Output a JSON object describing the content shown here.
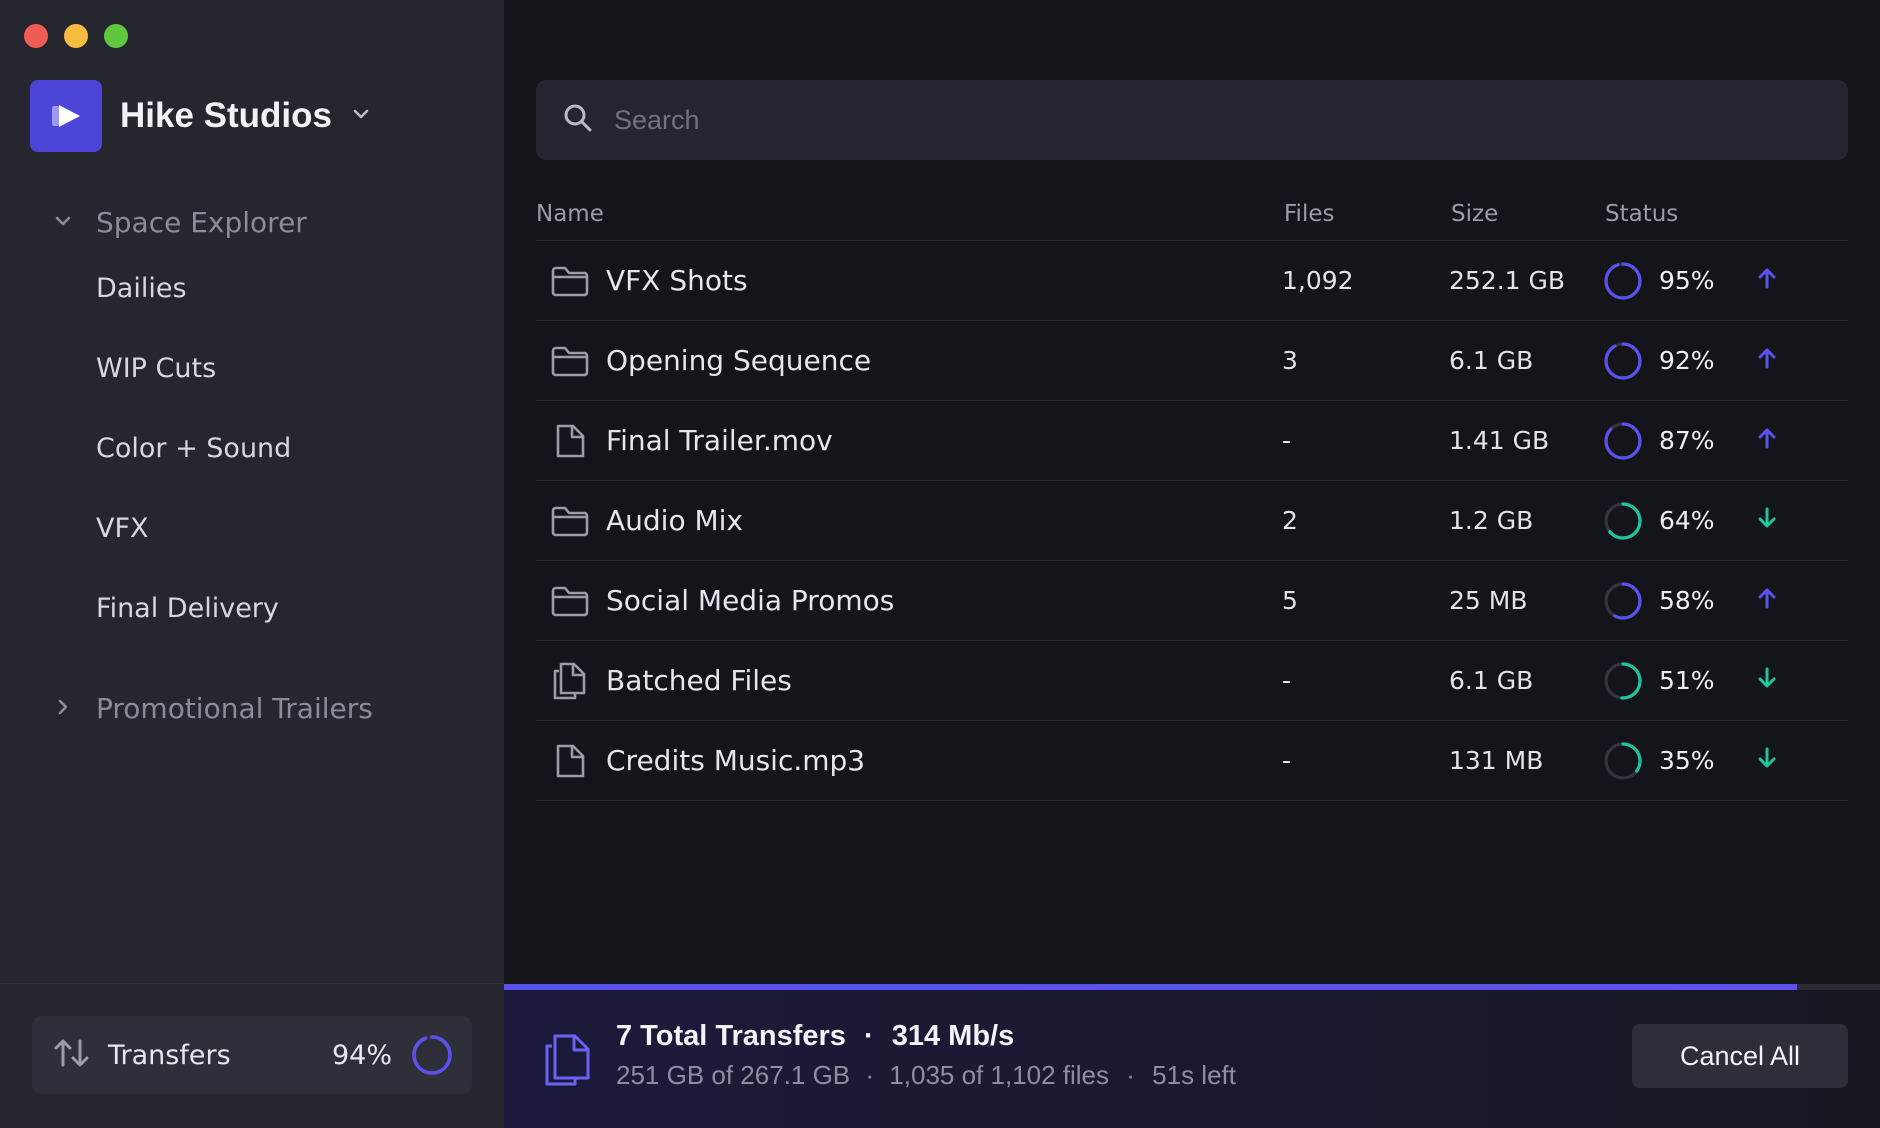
{
  "workspace": {
    "name": "Hike Studios"
  },
  "sidebar": {
    "groups": [
      {
        "label": "Space Explorer",
        "expanded": true,
        "items": [
          "Dailies",
          "WIP Cuts",
          "Color + Sound",
          "VFX",
          "Final Delivery"
        ]
      },
      {
        "label": "Promotional Trailers",
        "expanded": false,
        "items": []
      }
    ],
    "transfers": {
      "label": "Transfers",
      "percent_text": "94%",
      "percent": 94
    }
  },
  "search": {
    "placeholder": "Search"
  },
  "table": {
    "columns": [
      "Name",
      "Files",
      "Size",
      "Status"
    ],
    "rows": [
      {
        "icon": "folder-icon",
        "name": "VFX Shots",
        "files": "1,092",
        "size": "252.1 GB",
        "percent": 95,
        "percent_text": "95%",
        "direction": "up"
      },
      {
        "icon": "folder-icon",
        "name": "Opening Sequence",
        "files": "3",
        "size": "6.1 GB",
        "percent": 92,
        "percent_text": "92%",
        "direction": "up"
      },
      {
        "icon": "file-icon",
        "name": "Final Trailer.mov",
        "files": "-",
        "size": "1.41 GB",
        "percent": 87,
        "percent_text": "87%",
        "direction": "up"
      },
      {
        "icon": "folder-icon",
        "name": "Audio Mix",
        "files": "2",
        "size": "1.2 GB",
        "percent": 64,
        "percent_text": "64%",
        "direction": "down"
      },
      {
        "icon": "folder-icon",
        "name": "Social Media Promos",
        "files": "5",
        "size": "25 MB",
        "percent": 58,
        "percent_text": "58%",
        "direction": "up"
      },
      {
        "icon": "files-icon",
        "name": "Batched Files",
        "files": "-",
        "size": "6.1 GB",
        "percent": 51,
        "percent_text": "51%",
        "direction": "down"
      },
      {
        "icon": "file-icon",
        "name": "Credits Music.mp3",
        "files": "-",
        "size": "131 MB",
        "percent": 35,
        "percent_text": "35%",
        "direction": "down"
      }
    ]
  },
  "summary": {
    "title": "7 Total Transfers",
    "speed": "314 Mb/s",
    "size_progress": "251 GB of 267.1 GB",
    "files_progress": "1,035 of 1,102 files",
    "time_left": "51s left",
    "progress": 0.94,
    "cancel_label": "Cancel All"
  },
  "colors": {
    "upload": "#5b52ee",
    "download": "#21c59a",
    "accent": "#4d45d8"
  }
}
